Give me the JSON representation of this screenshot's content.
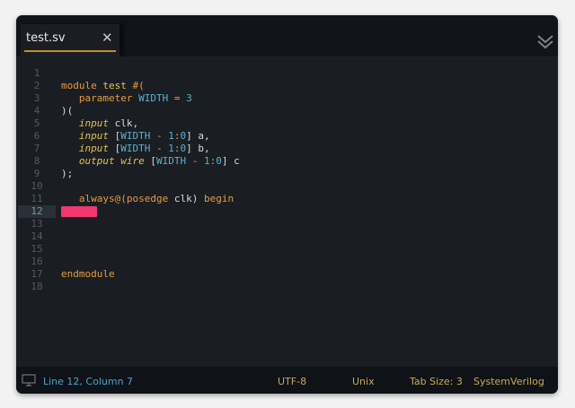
{
  "tab": {
    "title": "test.sv",
    "close_glyph": "✕",
    "icons": {
      "close": "close-icon",
      "overflow": "chevrons-down-icon"
    }
  },
  "editor": {
    "current_line": 12,
    "lines": [
      {
        "n": "1",
        "tokens": []
      },
      {
        "n": "2",
        "tokens": [
          [
            "kw",
            "module"
          ],
          [
            "pl",
            " "
          ],
          [
            "tp2",
            "test"
          ],
          [
            "pl",
            " "
          ],
          [
            "kw",
            "#("
          ]
        ]
      },
      {
        "n": "3",
        "tokens": [
          [
            "pl",
            "   "
          ],
          [
            "kw",
            "parameter"
          ],
          [
            "pl",
            " "
          ],
          [
            "id",
            "WIDTH"
          ],
          [
            "pl",
            " "
          ],
          [
            "kw",
            "="
          ],
          [
            "pl",
            " "
          ],
          [
            "id",
            "3"
          ]
        ]
      },
      {
        "n": "4",
        "tokens": [
          [
            "pl",
            ")("
          ]
        ]
      },
      {
        "n": "5",
        "tokens": [
          [
            "pl",
            "   "
          ],
          [
            "tp",
            "input"
          ],
          [
            "pl",
            " clk,"
          ]
        ]
      },
      {
        "n": "6",
        "tokens": [
          [
            "pl",
            "   "
          ],
          [
            "tp",
            "input"
          ],
          [
            "pl",
            " ["
          ],
          [
            "id",
            "WIDTH"
          ],
          [
            "pl",
            " "
          ],
          [
            "kw",
            "-"
          ],
          [
            "pl",
            " "
          ],
          [
            "id",
            "1"
          ],
          [
            "kw",
            ":"
          ],
          [
            "id",
            "0"
          ],
          [
            "pl",
            "] a,"
          ]
        ]
      },
      {
        "n": "7",
        "tokens": [
          [
            "pl",
            "   "
          ],
          [
            "tp",
            "input"
          ],
          [
            "pl",
            " ["
          ],
          [
            "id",
            "WIDTH"
          ],
          [
            "pl",
            " "
          ],
          [
            "kw",
            "-"
          ],
          [
            "pl",
            " "
          ],
          [
            "id",
            "1"
          ],
          [
            "kw",
            ":"
          ],
          [
            "id",
            "0"
          ],
          [
            "pl",
            "] b,"
          ]
        ]
      },
      {
        "n": "8",
        "tokens": [
          [
            "pl",
            "   "
          ],
          [
            "tp",
            "output"
          ],
          [
            "pl",
            " "
          ],
          [
            "tp",
            "wire"
          ],
          [
            "pl",
            " ["
          ],
          [
            "id",
            "WIDTH"
          ],
          [
            "pl",
            " "
          ],
          [
            "kw",
            "-"
          ],
          [
            "pl",
            " "
          ],
          [
            "id",
            "1"
          ],
          [
            "kw",
            ":"
          ],
          [
            "id",
            "0"
          ],
          [
            "pl",
            "] c"
          ]
        ]
      },
      {
        "n": "9",
        "tokens": [
          [
            "pl",
            ");"
          ]
        ]
      },
      {
        "n": "10",
        "tokens": []
      },
      {
        "n": "11",
        "tokens": [
          [
            "pl",
            "   "
          ],
          [
            "kw",
            "always@(posedge"
          ],
          [
            "pl",
            " clk) "
          ],
          [
            "kw",
            "begin"
          ]
        ]
      },
      {
        "n": "12",
        "tokens": []
      },
      {
        "n": "13",
        "tokens": []
      },
      {
        "n": "14",
        "tokens": []
      },
      {
        "n": "15",
        "tokens": []
      },
      {
        "n": "16",
        "tokens": []
      },
      {
        "n": "17",
        "tokens": [
          [
            "kw",
            "endmodule"
          ]
        ]
      },
      {
        "n": "18",
        "tokens": []
      }
    ]
  },
  "status": {
    "position": "Line 12, Column 7",
    "encoding": "UTF-8",
    "line_endings": "Unix",
    "tab_size": "Tab Size: 3",
    "language": "SystemVerilog",
    "icons": {
      "panel": "screen-icon"
    }
  },
  "colors": {
    "keyword": "#e89a3c",
    "type": "#e2c14a",
    "identifier": "#5ab0ce",
    "plain": "#d8d8d8",
    "highlight": "#f0376e",
    "status_text": "#c7a95a",
    "status_position": "#4aa3c9"
  }
}
